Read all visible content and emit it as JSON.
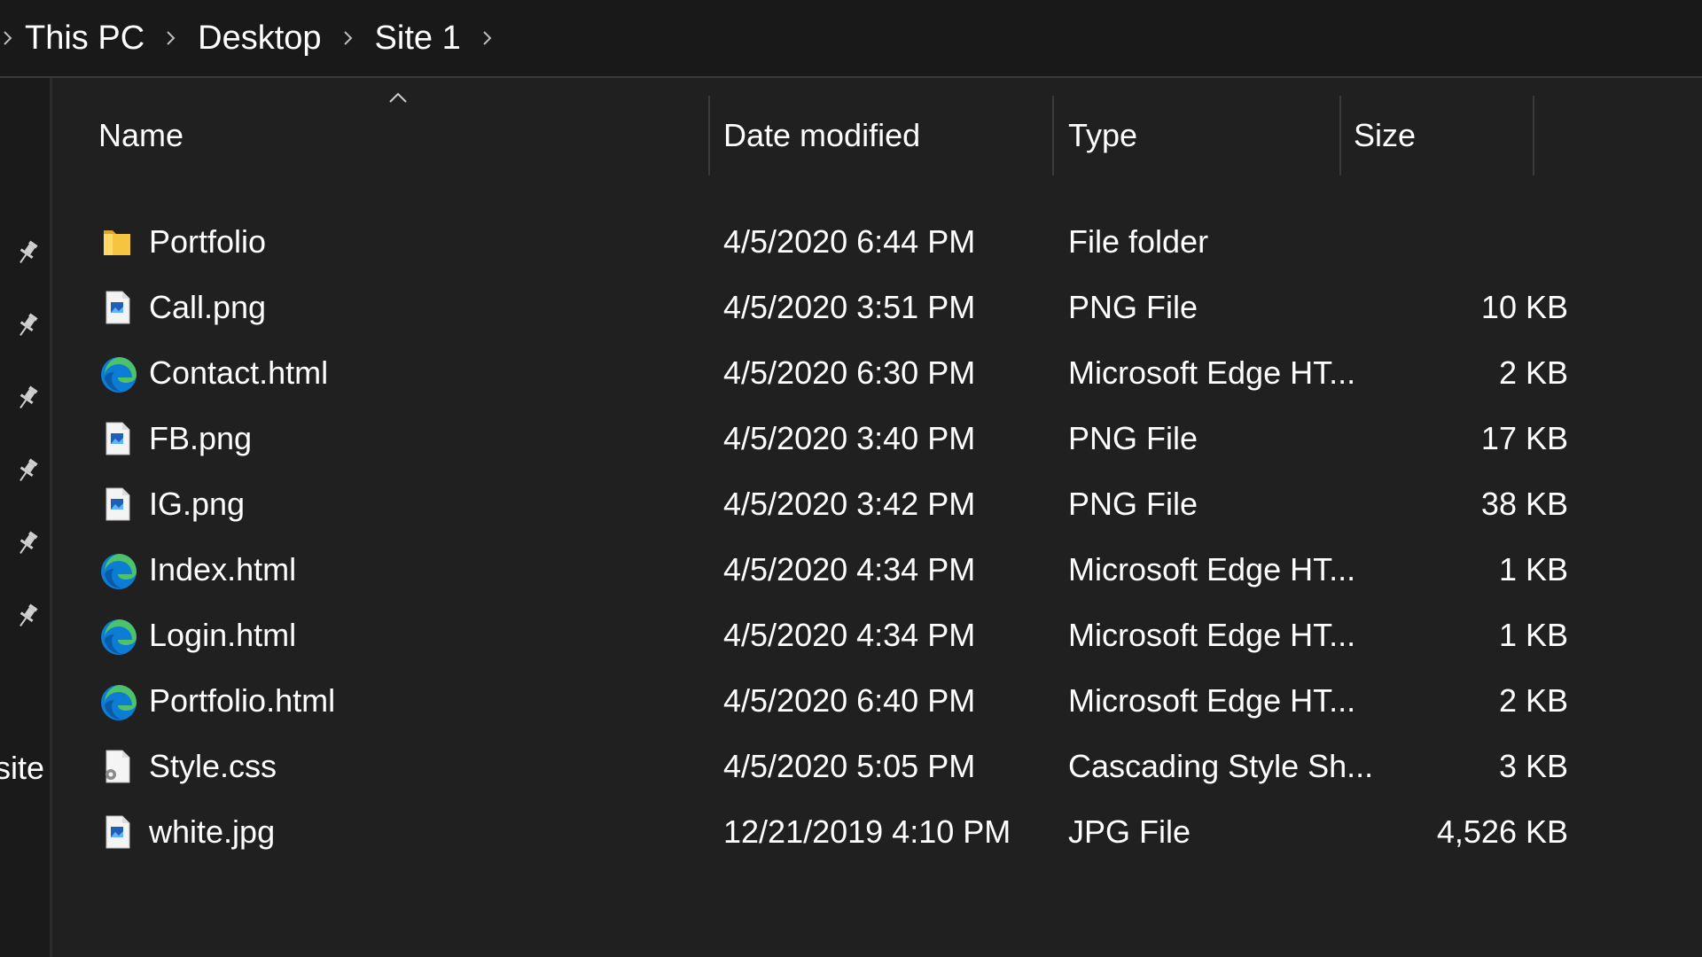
{
  "breadcrumb": [
    "This PC",
    "Desktop",
    "Site 1"
  ],
  "nav_label": "site",
  "columns": {
    "name": "Name",
    "date": "Date modified",
    "type": "Type",
    "size": "Size"
  },
  "sort": {
    "column": "name",
    "direction": "ascending"
  },
  "files": [
    {
      "name": "Portfolio",
      "date": "4/5/2020 6:44 PM",
      "type": "File folder",
      "size": "",
      "icon": "folder-icon"
    },
    {
      "name": "Call.png",
      "date": "4/5/2020 3:51 PM",
      "type": "PNG File",
      "size": "10 KB",
      "icon": "image-file-icon"
    },
    {
      "name": "Contact.html",
      "date": "4/5/2020 6:30 PM",
      "type": "Microsoft Edge HT...",
      "size": "2 KB",
      "icon": "edge-icon"
    },
    {
      "name": "FB.png",
      "date": "4/5/2020 3:40 PM",
      "type": "PNG File",
      "size": "17 KB",
      "icon": "image-file-icon"
    },
    {
      "name": "IG.png",
      "date": "4/5/2020 3:42 PM",
      "type": "PNG File",
      "size": "38 KB",
      "icon": "image-file-icon"
    },
    {
      "name": "Index.html",
      "date": "4/5/2020 4:34 PM",
      "type": "Microsoft Edge HT...",
      "size": "1 KB",
      "icon": "edge-icon"
    },
    {
      "name": "Login.html",
      "date": "4/5/2020 4:34 PM",
      "type": "Microsoft Edge HT...",
      "size": "1 KB",
      "icon": "edge-icon"
    },
    {
      "name": "Portfolio.html",
      "date": "4/5/2020 6:40 PM",
      "type": "Microsoft Edge HT...",
      "size": "2 KB",
      "icon": "edge-icon"
    },
    {
      "name": "Style.css",
      "date": "4/5/2020 5:05 PM",
      "type": "Cascading Style Sh...",
      "size": "3 KB",
      "icon": "css-file-icon"
    },
    {
      "name": "white.jpg",
      "date": "12/21/2019 4:10 PM",
      "type": "JPG File",
      "size": "4,526 KB",
      "icon": "image-file-icon"
    }
  ],
  "colors": {
    "background": "#202020",
    "address_bar": "#191919",
    "folder": "#f5c542",
    "edge_blue": "#0c7cd5",
    "edge_green": "#4cc36a"
  }
}
